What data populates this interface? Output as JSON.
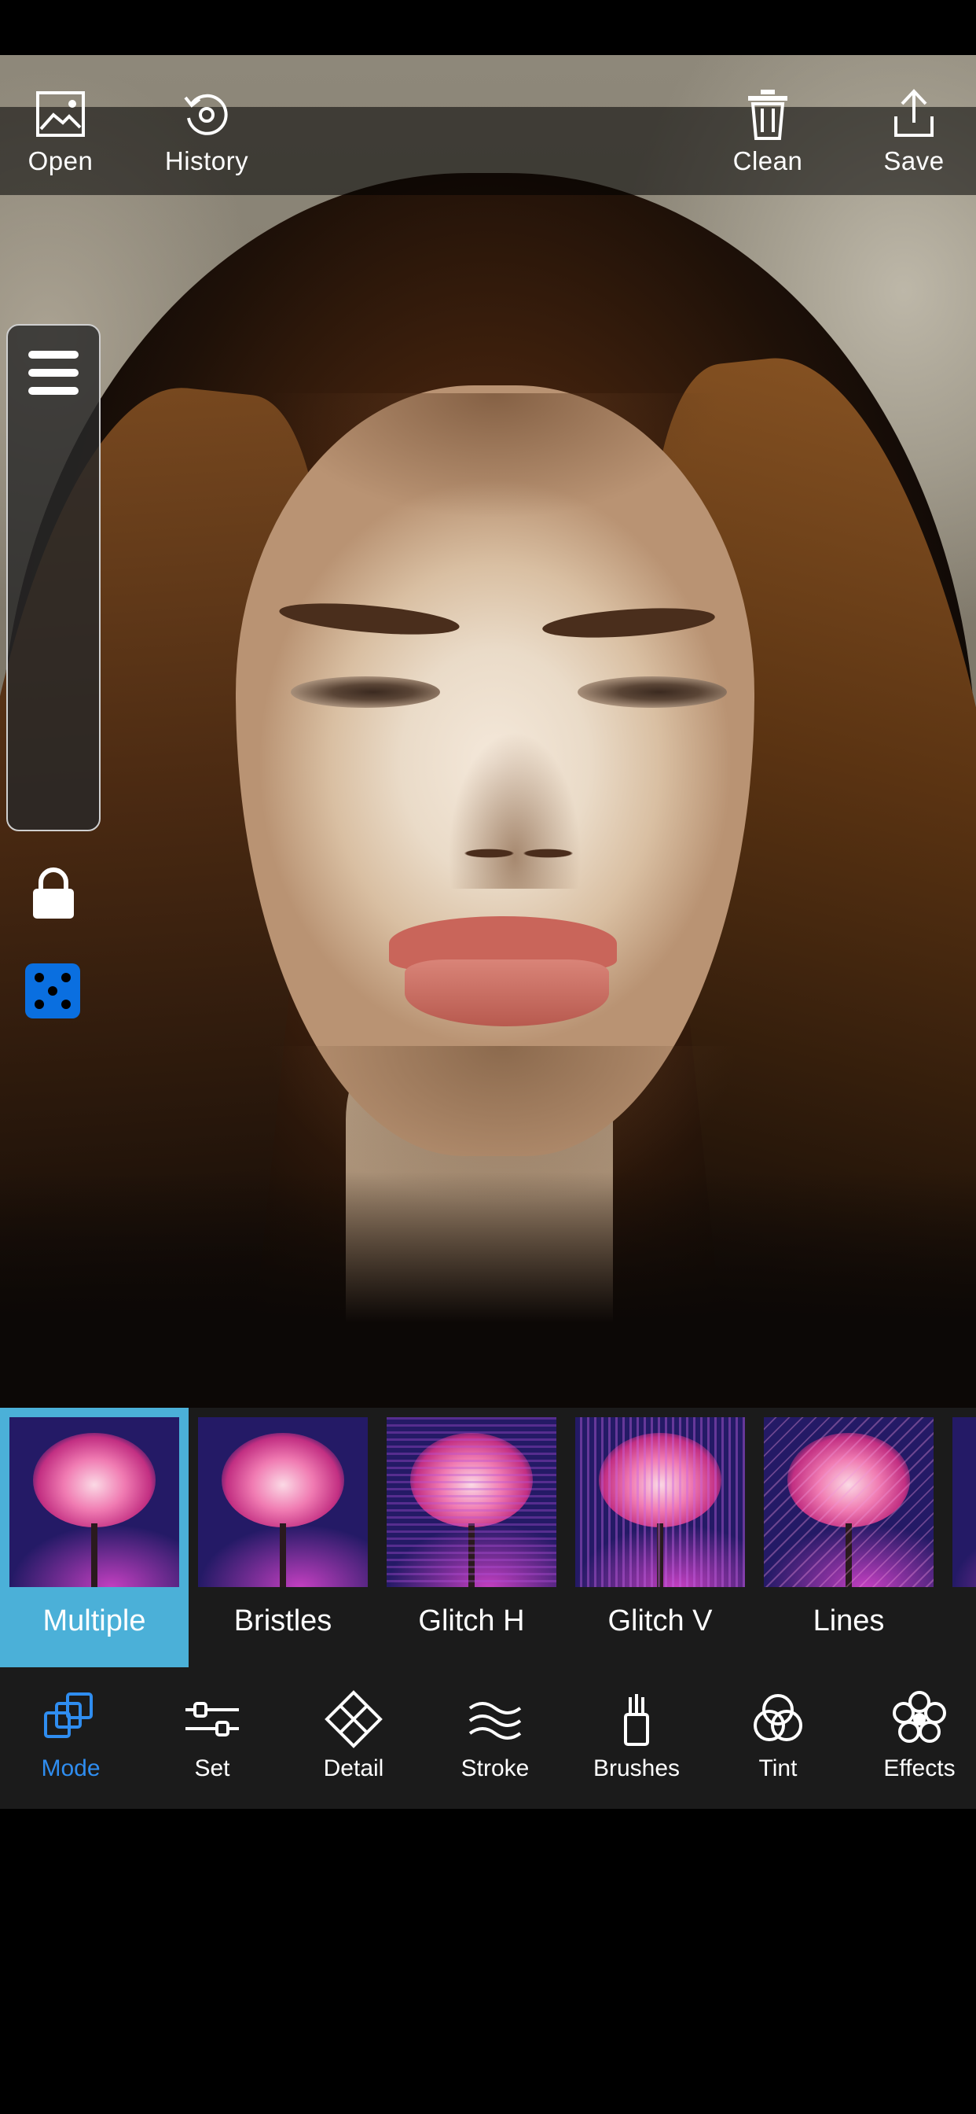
{
  "top_bar": {
    "open_label": "Open",
    "history_label": "History",
    "clean_label": "Clean",
    "save_label": "Save"
  },
  "side_panel": {
    "icons": [
      "menu-icon",
      "lock-icon",
      "dice-icon"
    ]
  },
  "mode_strip": {
    "selected": "Multiple",
    "items": [
      {
        "label": "Multiple"
      },
      {
        "label": "Bristles"
      },
      {
        "label": "Glitch H"
      },
      {
        "label": "Glitch V"
      },
      {
        "label": "Lines"
      }
    ]
  },
  "toolbar": {
    "active": "Mode",
    "active_color": "#2f8df0",
    "items": [
      {
        "label": "Mode",
        "icon": "layers-icon"
      },
      {
        "label": "Set",
        "icon": "sliders-icon"
      },
      {
        "label": "Detail",
        "icon": "grid-diamond-icon"
      },
      {
        "label": "Stroke",
        "icon": "waves-icon"
      },
      {
        "label": "Brushes",
        "icon": "brushes-icon"
      },
      {
        "label": "Tint",
        "icon": "circles-icon"
      },
      {
        "label": "Effects",
        "icon": "flower-icon"
      }
    ]
  },
  "colors": {
    "accent": "#2f8df0",
    "selected_mode_bg": "#4bb0d8",
    "dice_bg": "#0a6fe0"
  }
}
